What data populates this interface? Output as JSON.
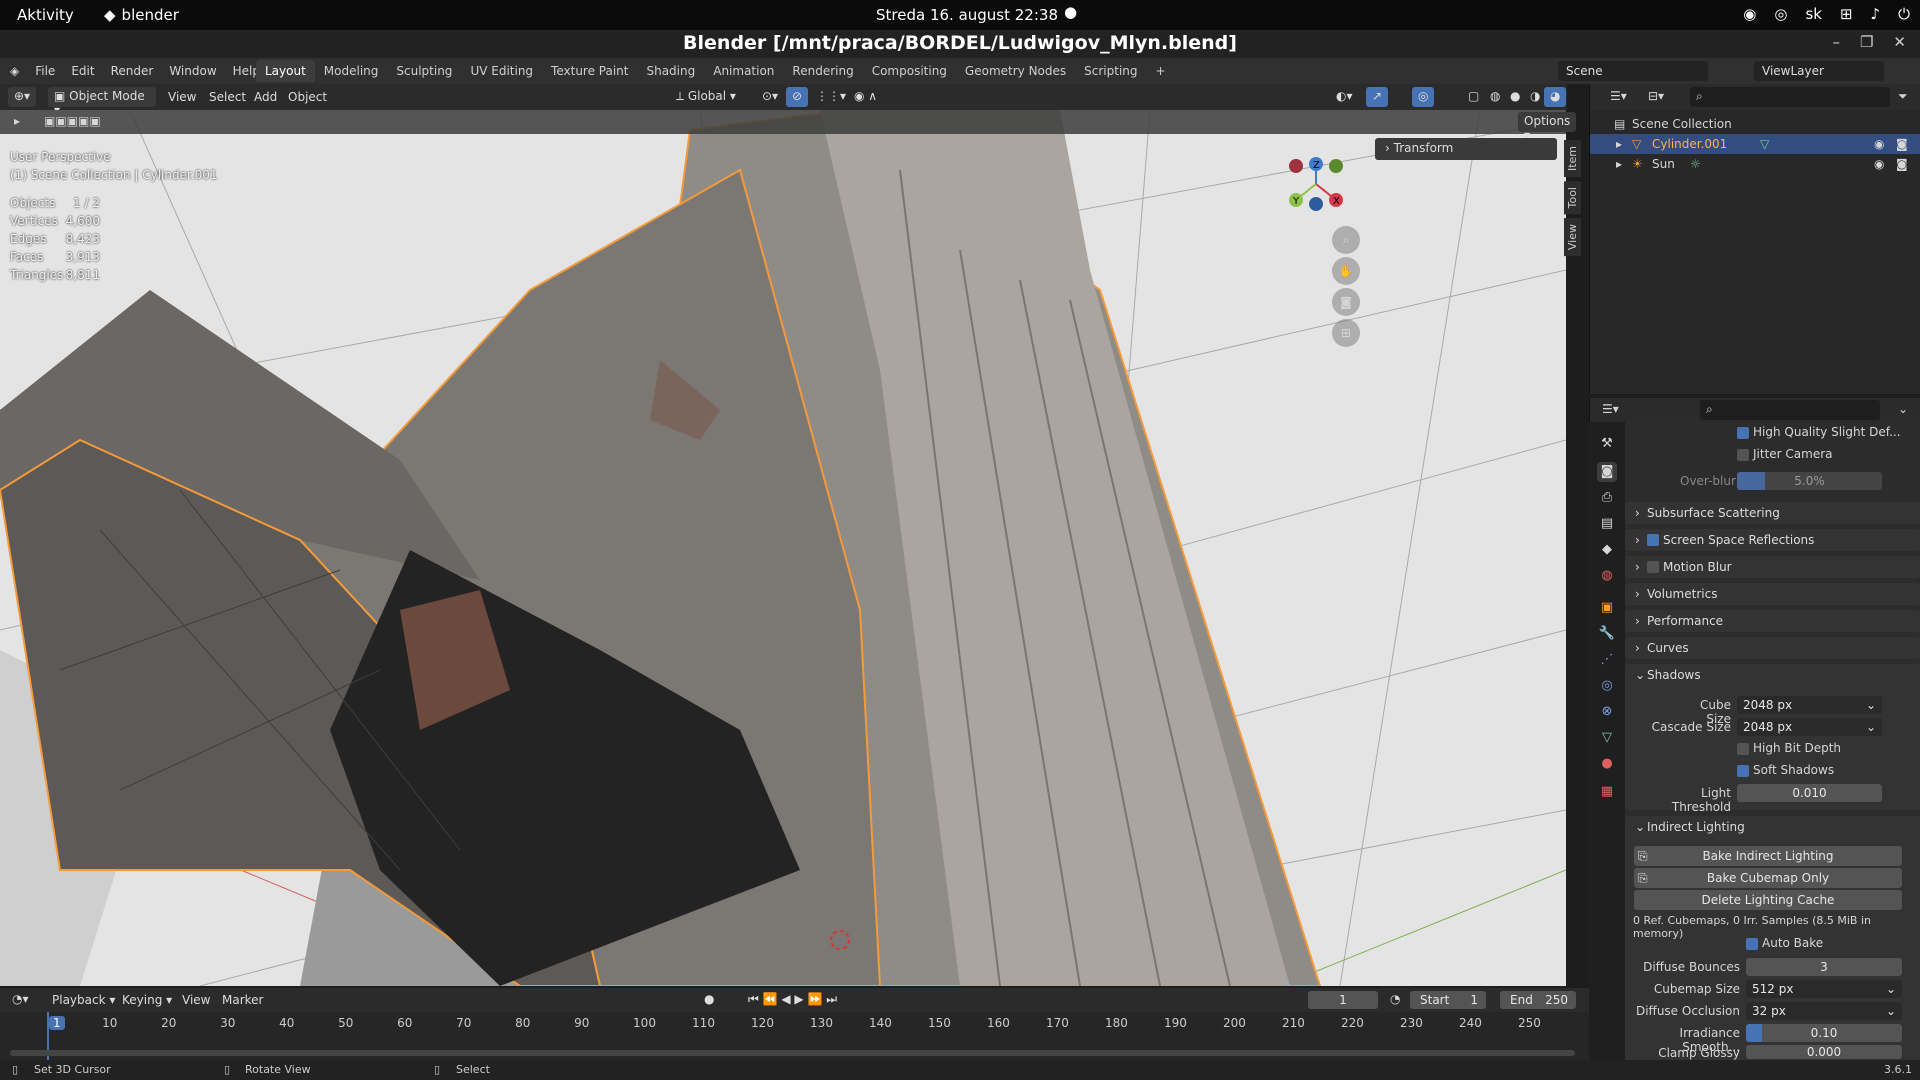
{
  "gnome": {
    "activities": "Aktivity",
    "app_name": "blender",
    "clock": "Streda 16. august  22:38",
    "lang": "sk"
  },
  "window": {
    "title": "Blender [/mnt/praca/BORDEL/Ludwigov_Mlyn.blend]"
  },
  "menu": {
    "items": [
      "File",
      "Edit",
      "Render",
      "Window",
      "Help"
    ],
    "workspaces": [
      "Layout",
      "Modeling",
      "Sculpting",
      "UV Editing",
      "Texture Paint",
      "Shading",
      "Animation",
      "Rendering",
      "Compositing",
      "Geometry Nodes",
      "Scripting"
    ],
    "add_workspace": "+",
    "scene": "Scene",
    "view_layer": "ViewLayer"
  },
  "viewport_header": {
    "mode": "Object Mode",
    "menus": [
      "View",
      "Select",
      "Add",
      "Object"
    ],
    "orientation": "Global",
    "options": "Options"
  },
  "viewport": {
    "view_name": "User Perspective",
    "collection": "(1) Scene Collection | Cylinder.001",
    "stats": [
      {
        "label": "Objects",
        "value": "1 / 2"
      },
      {
        "label": "Vertices",
        "value": "4,600"
      },
      {
        "label": "Edges",
        "value": "8,423"
      },
      {
        "label": "Faces",
        "value": "3,913"
      },
      {
        "label": "Triangles",
        "value": "8,811"
      }
    ],
    "transform_panel": "Transform",
    "side_tabs": [
      "Item",
      "Tool",
      "View"
    ],
    "gizmo": {
      "z": "Z",
      "y": "Y",
      "x": "X"
    }
  },
  "outliner": {
    "root": "Scene Collection",
    "items": [
      {
        "name": "Cylinder.001",
        "selected": true
      },
      {
        "name": "Sun",
        "selected": false
      }
    ]
  },
  "properties": {
    "high_quality_slight_def": "High Quality Slight Def...",
    "jitter_camera": "Jitter Camera",
    "overblur_label": "Over-blur",
    "overblur_value": "5.0%",
    "overblur_fraction": 0.05,
    "panels": [
      {
        "label": "Subsurface Scattering",
        "checkbox": false
      },
      {
        "label": "Screen Space Reflections",
        "checkbox": true
      },
      {
        "label": "Motion Blur",
        "checkbox": false
      },
      {
        "label": "Volumetrics",
        "checkbox": null
      },
      {
        "label": "Performance",
        "checkbox": null
      },
      {
        "label": "Curves",
        "checkbox": null
      }
    ],
    "shadows": {
      "title": "Shadows",
      "cube_size_label": "Cube Size",
      "cube_size": "2048 px",
      "cascade_size_label": "Cascade Size",
      "cascade_size": "2048 px",
      "high_bit_depth": "High Bit Depth",
      "soft_shadows": "Soft Shadows",
      "light_threshold_label": "Light Threshold",
      "light_threshold": "0.010"
    },
    "indirect": {
      "title": "Indirect Lighting",
      "bake": "Bake Indirect Lighting",
      "bake_cubemap": "Bake Cubemap Only",
      "delete_cache": "Delete Lighting Cache",
      "info": "0 Ref. Cubemaps, 0 Irr. Samples (8.5 MiB in memory)",
      "auto_bake": "Auto Bake",
      "diffuse_bounces_label": "Diffuse Bounces",
      "diffuse_bounces": "3",
      "cubemap_size_label": "Cubemap Size",
      "cubemap_size": "512 px",
      "diffuse_occlusion_label": "Diffuse Occlusion",
      "diffuse_occlusion": "32 px",
      "irradiance_smooth_label": "Irradiance Smooth...",
      "irradiance_smooth": "0.10",
      "irradiance_smooth_fraction": 0.1,
      "clamp_glossy_label": "Clamp Glossy",
      "clamp_glossy": "0.000"
    }
  },
  "timeline": {
    "menus": [
      "Playback",
      "Keying",
      "View",
      "Marker"
    ],
    "current_frame": "1",
    "start_label": "Start",
    "start": "1",
    "end_label": "End",
    "end": "250",
    "ticks": [
      "1",
      "10",
      "20",
      "30",
      "40",
      "50",
      "60",
      "70",
      "80",
      "90",
      "100",
      "110",
      "120",
      "130",
      "140",
      "150",
      "160",
      "170",
      "180",
      "190",
      "200",
      "210",
      "220",
      "230",
      "240",
      "250"
    ]
  },
  "statusbar": {
    "set_cursor": "Set 3D Cursor",
    "rotate_view": "Rotate View",
    "select": "Select",
    "version": "3.6.1"
  },
  "colors": {
    "accent_blue": "#4772b3",
    "selection_orange": "#f39a3a",
    "gizmo_x": "#d5384a",
    "gizmo_y": "#8bc34a",
    "gizmo_z": "#3f7ccf"
  }
}
